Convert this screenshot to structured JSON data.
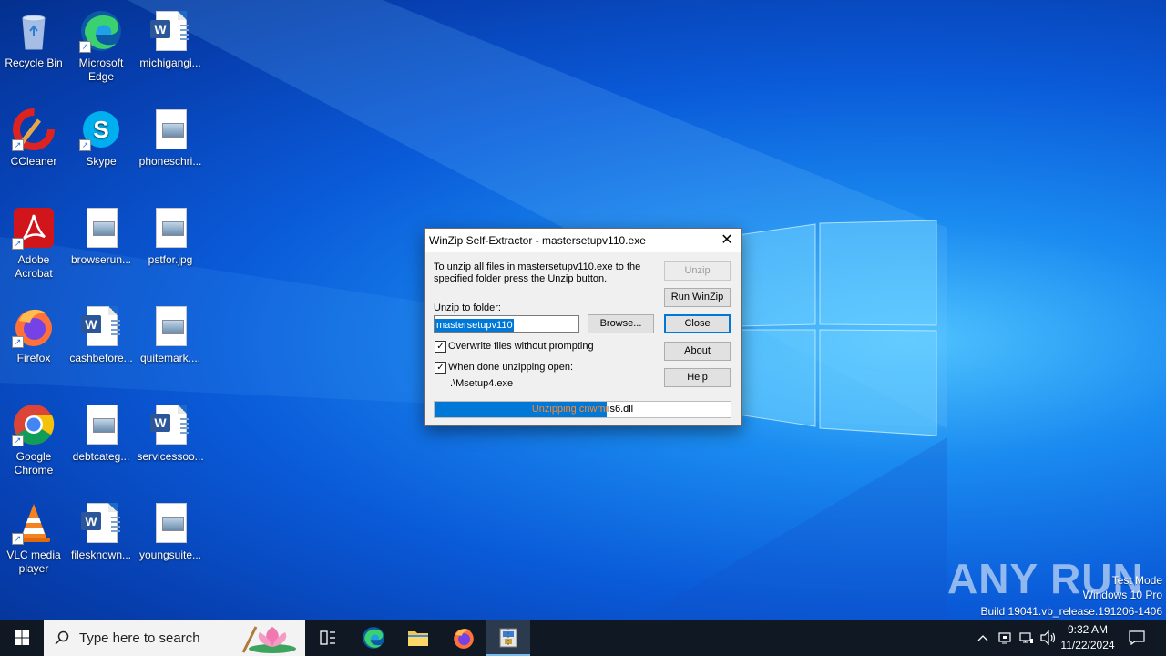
{
  "desktop": {
    "icons": [
      {
        "label": "Recycle Bin"
      },
      {
        "label": "Microsoft Edge"
      },
      {
        "label": "michigangi..."
      },
      {
        "label": "CCleaner"
      },
      {
        "label": "Skype"
      },
      {
        "label": "phoneschri..."
      },
      {
        "label": "Adobe Acrobat"
      },
      {
        "label": "browserun..."
      },
      {
        "label": "pstfor.jpg"
      },
      {
        "label": "Firefox"
      },
      {
        "label": "cashbefore..."
      },
      {
        "label": "quitemark...."
      },
      {
        "label": "Google Chrome"
      },
      {
        "label": "debtcateg..."
      },
      {
        "label": "servicessoo..."
      },
      {
        "label": "VLC media player"
      },
      {
        "label": "filesknown..."
      },
      {
        "label": "youngsuite..."
      }
    ]
  },
  "dialog": {
    "title": "WinZip Self-Extractor - mastersetupv110.exe",
    "close_glyph": "✕",
    "instruction_line1": "To unzip all files in mastersetupv110.exe to the",
    "instruction_line2": "specified folder press the Unzip button.",
    "unzip_to_label": "Unzip to folder:",
    "folder_value": "mastersetupv110",
    "browse_label": "Browse...",
    "overwrite_label": "Overwrite files without prompting",
    "overwrite_checked": true,
    "when_done_label": "When done unzipping open:",
    "when_done_checked": true,
    "open_target": ".\\Msetup4.exe",
    "buttons": {
      "unzip": "Unzip",
      "run_winzip": "Run WinZip",
      "close": "Close",
      "about": "About",
      "help": "Help"
    },
    "progress_text": "Unzipping cnwmiis6.dll",
    "progress_fraction": 0.58
  },
  "watermark": {
    "brand": "ANY RUN",
    "mode": "Test Mode",
    "edition": "Windows 10 Pro",
    "build": "Build 19041.vb_release.191206-1406"
  },
  "taskbar": {
    "search_placeholder": "Type here to search",
    "time": "9:32 AM",
    "date": "11/22/2024"
  }
}
